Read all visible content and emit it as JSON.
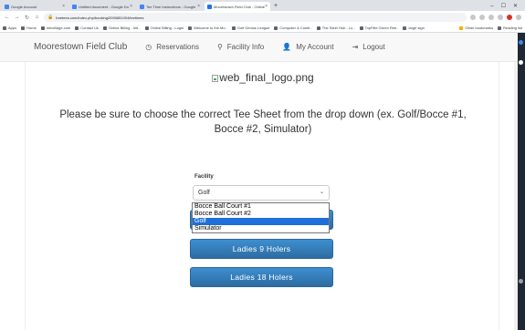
{
  "browser": {
    "tabs": [
      {
        "title": "Google Account",
        "active": false,
        "fav_color": "#4285f4"
      },
      {
        "title": "Untitled document - Google Do",
        "active": false,
        "fav_color": "#4285f4"
      },
      {
        "title": "Tee Time Instructions - Google",
        "active": false,
        "fav_color": "#4285f4"
      },
      {
        "title": "Moorestown Field Club - Online",
        "active": true,
        "fav_color": "#1a73e8"
      }
    ],
    "new_tab": "+",
    "window_controls": [
      "–",
      "☐",
      "✕"
    ],
    "url": "foretees.com/index.php/booking/2090651004/teetimes",
    "bookmarks": [
      "Apps",
      "Home",
      "mfcvillage.com",
      "Contact Us",
      "Online Billing - Intl..",
      "Online Billing - Login",
      "Welcome to the Mo..",
      "Golf Genius League",
      "Computer & Confe..",
      "The Steel Hub - Lu..",
      "TopFlite Green Ree..",
      "large sign"
    ],
    "bookmarks_right": [
      "Other bookmarks",
      "Reading list"
    ]
  },
  "navbar": {
    "brand": "Moorestown Field Club",
    "links": [
      {
        "label": "Reservations",
        "icon": "clock-icon",
        "glyph": "◷"
      },
      {
        "label": "Facility Info",
        "icon": "map-marker-icon",
        "glyph": "⚲"
      },
      {
        "label": "My Account",
        "icon": "user-icon",
        "glyph": "👤"
      },
      {
        "label": "Logout",
        "icon": "logout-icon",
        "glyph": "⇥"
      }
    ]
  },
  "main": {
    "logo_alt": "web_final_logo.png",
    "instruction": "Please be sure to choose the correct Tee Sheet from the drop down (ex. Golf/Bocce #1, Bocce #2, Simulator)",
    "facility_label": "Facility",
    "facility_selected": "Golf",
    "facility_options": [
      "Bocce Ball Court #1",
      "Bocce Ball Court #2",
      "Golf",
      "Simulator"
    ],
    "buttons": [
      {
        "label": ""
      },
      {
        "label": "Ladies 9 Holers"
      },
      {
        "label": "Ladies 18 Holers"
      }
    ]
  },
  "colors": {
    "accent": "#337ab7",
    "selected_option": "#1e6fd9",
    "navbar_bg": "#f8f8f8"
  }
}
